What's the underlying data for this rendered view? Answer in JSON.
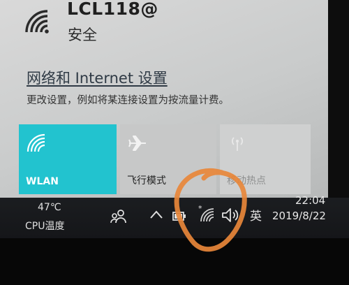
{
  "network": {
    "name": "LCL118@",
    "status": "安全"
  },
  "settings": {
    "link_label": "网络和 Internet 设置",
    "description": "更改设置，例如将某连接设置为按流量计费。"
  },
  "quick_actions": [
    {
      "label": "WLAN",
      "icon": "wifi-icon",
      "state": "on",
      "color": "#22c3cf"
    },
    {
      "label": "飞行模式",
      "icon": "airplane-icon",
      "state": "off"
    },
    {
      "label": "移动热点",
      "icon": "hotspot-icon",
      "state": "disabled"
    }
  ],
  "taskbar": {
    "temperature": "47℃",
    "cpu_label": "CPU温度",
    "language": "英",
    "time": "22:04",
    "date": "2019/8/22",
    "tray_icons": [
      "people-icon",
      "chevron-up-icon",
      "battery-icon",
      "wifi-icon",
      "volume-icon"
    ]
  },
  "annotation_color": "#e8873a"
}
